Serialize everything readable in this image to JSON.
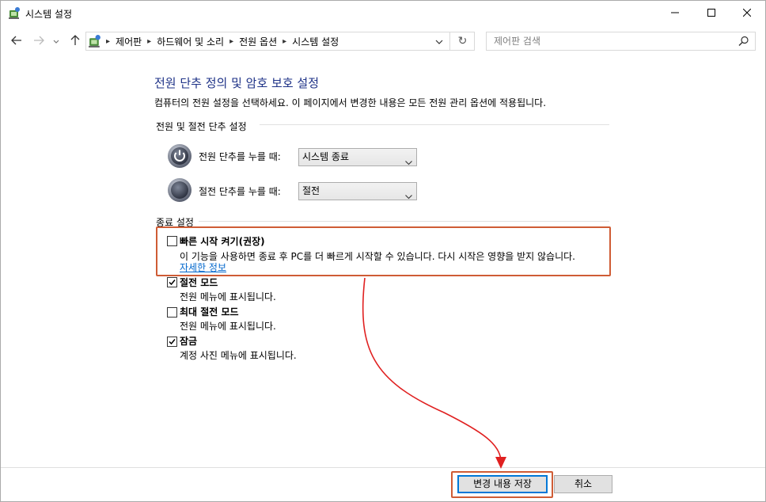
{
  "window": {
    "title": "시스템 설정"
  },
  "nav": {
    "breadcrumbs": [
      "제어판",
      "하드웨어 및 소리",
      "전원 옵션",
      "시스템 설정"
    ],
    "search_placeholder": "제어판 검색"
  },
  "page": {
    "title": "전원 단추 정의 및 암호 보호 설정",
    "description": "컴퓨터의 전원 설정을 선택하세요. 이 페이지에서 변경한 내용은 모든 전원 관리 옵션에 적용됩니다."
  },
  "power_section": {
    "header": "전원 및 절전 단추 설정",
    "power_button_label": "전원 단추를 누를 때:",
    "power_button_value": "시스템 종료",
    "sleep_button_label": "절전 단추를 누를 때:",
    "sleep_button_value": "절전"
  },
  "shutdown_section": {
    "header": "종료 설정",
    "options": [
      {
        "title": "빠른 시작 켜기(권장)",
        "desc": "이 기능을 사용하면 종료 후 PC를 더 빠르게 시작할 수 있습니다. 다시 시작은 영향을 받지 않습니다.",
        "checked": false,
        "link": "자세한 정보"
      },
      {
        "title": "절전 모드",
        "desc": "전원 메뉴에 표시됩니다.",
        "checked": true
      },
      {
        "title": "최대 절전 모드",
        "desc": "전원 메뉴에 표시됩니다.",
        "checked": false
      },
      {
        "title": "잠금",
        "desc": "계정 사진 메뉴에 표시됩니다.",
        "checked": true
      }
    ]
  },
  "buttons": {
    "save": "변경 내용 저장",
    "cancel": "취소"
  },
  "colors": {
    "title_blue": "#1e3287",
    "link_blue": "#0066cc",
    "highlight": "#cf5c35",
    "arrow": "#e02020"
  }
}
